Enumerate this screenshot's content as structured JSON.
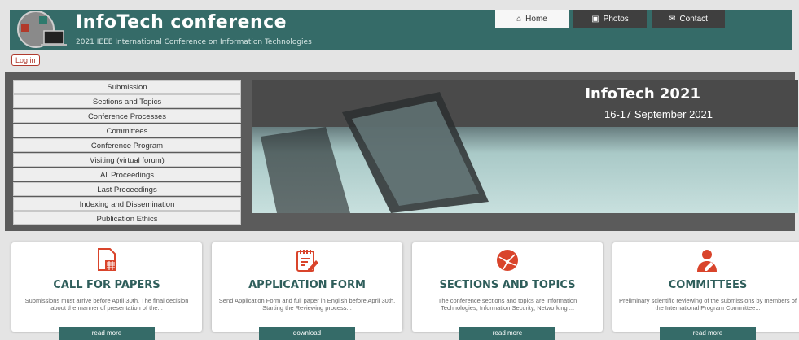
{
  "header": {
    "title": "InfoTech conference",
    "subtitle": "2021 IEEE International Conference on Information Technologies"
  },
  "nav": [
    {
      "label": "Home",
      "icon": "home-icon",
      "active": true
    },
    {
      "label": "Photos",
      "icon": "camera-icon",
      "active": false
    },
    {
      "label": "Contact",
      "icon": "envelope-icon",
      "active": false
    }
  ],
  "login_label": "Log in",
  "sidebar": {
    "items": [
      {
        "label": "Submission"
      },
      {
        "label": "Sections and Topics"
      },
      {
        "label": "Conference Processes"
      },
      {
        "label": "Committees"
      },
      {
        "label": "Conference Program"
      },
      {
        "label": "Visiting (virtual forum)"
      },
      {
        "label": "All Proceedings"
      },
      {
        "label": "Last Proceedings"
      },
      {
        "label": "Indexing and Dissemination"
      },
      {
        "label": "Publication Ethics"
      }
    ]
  },
  "banner": {
    "title": "InfoTech 2021",
    "dates": "16-17 September 2021"
  },
  "cards": [
    {
      "title": "CALL FOR PAPERS",
      "icon": "document-calculator-icon",
      "text": "Submissions must arrive before April 30th. The final decision about the manner of presentation of the...",
      "button": "read more"
    },
    {
      "title": "APPLICATION FORM",
      "icon": "edit-form-icon",
      "text": "Send Application Form and full paper in English before April 30th. Starting the Reviewing process...",
      "button": "download"
    },
    {
      "title": "SECTIONS AND TOPICS",
      "icon": "network-globe-icon",
      "text": "The conference sections and topics are Information Technologies, Information Security, Networking ...",
      "button": "read more"
    },
    {
      "title": "COMMITTEES",
      "icon": "user-edit-icon",
      "text": "Preliminary scientific reviewing of the submissions by members of the International Program Committee...",
      "button": "read more"
    }
  ],
  "colors": {
    "teal": "#356b68",
    "accent": "#d9442b"
  }
}
